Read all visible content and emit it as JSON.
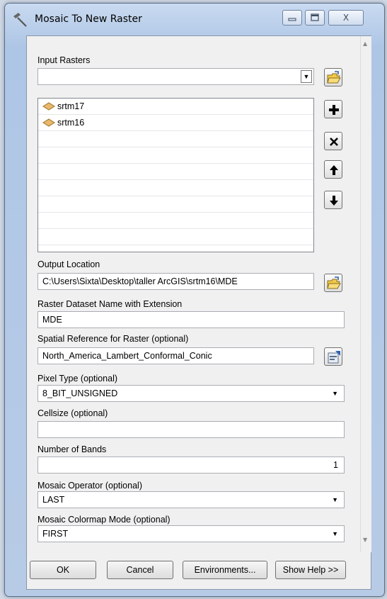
{
  "window": {
    "title": "Mosaic To New Raster",
    "close_label": "X"
  },
  "input_rasters": {
    "label": "Input Rasters",
    "value": "",
    "items": [
      "srtm17",
      "srtm16"
    ]
  },
  "output_location": {
    "label": "Output Location",
    "value": "C:\\Users\\Sixta\\Desktop\\taller ArcGIS\\srtm16\\MDE"
  },
  "dataset_name": {
    "label": "Raster Dataset Name with Extension",
    "value": "MDE"
  },
  "spatial_reference": {
    "label": "Spatial Reference for Raster (optional)",
    "value": "North_America_Lambert_Conformal_Conic"
  },
  "pixel_type": {
    "label": "Pixel Type (optional)",
    "value": "8_BIT_UNSIGNED"
  },
  "cellsize": {
    "label": "Cellsize (optional)",
    "value": ""
  },
  "number_of_bands": {
    "label": "Number of Bands",
    "value": "1"
  },
  "mosaic_operator": {
    "label": "Mosaic Operator (optional)",
    "value": "LAST"
  },
  "colormap_mode": {
    "label": "Mosaic Colormap Mode (optional)",
    "value": "FIRST"
  },
  "buttons": {
    "ok": "OK",
    "cancel": "Cancel",
    "environments": "Environments...",
    "show_help": "Show Help >>"
  },
  "icons": {
    "title": "hammer-icon",
    "browse": "open-folder-icon",
    "add": "plus-icon",
    "remove": "x-icon",
    "up": "arrow-up-icon",
    "down": "arrow-down-icon",
    "raster_item": "raster-dataset-icon",
    "spatial_ref": "properties-icon"
  },
  "colors": {
    "titlebar": "#c9daf0",
    "panel": "#f0f0f0",
    "field_border": "#abadb3"
  }
}
